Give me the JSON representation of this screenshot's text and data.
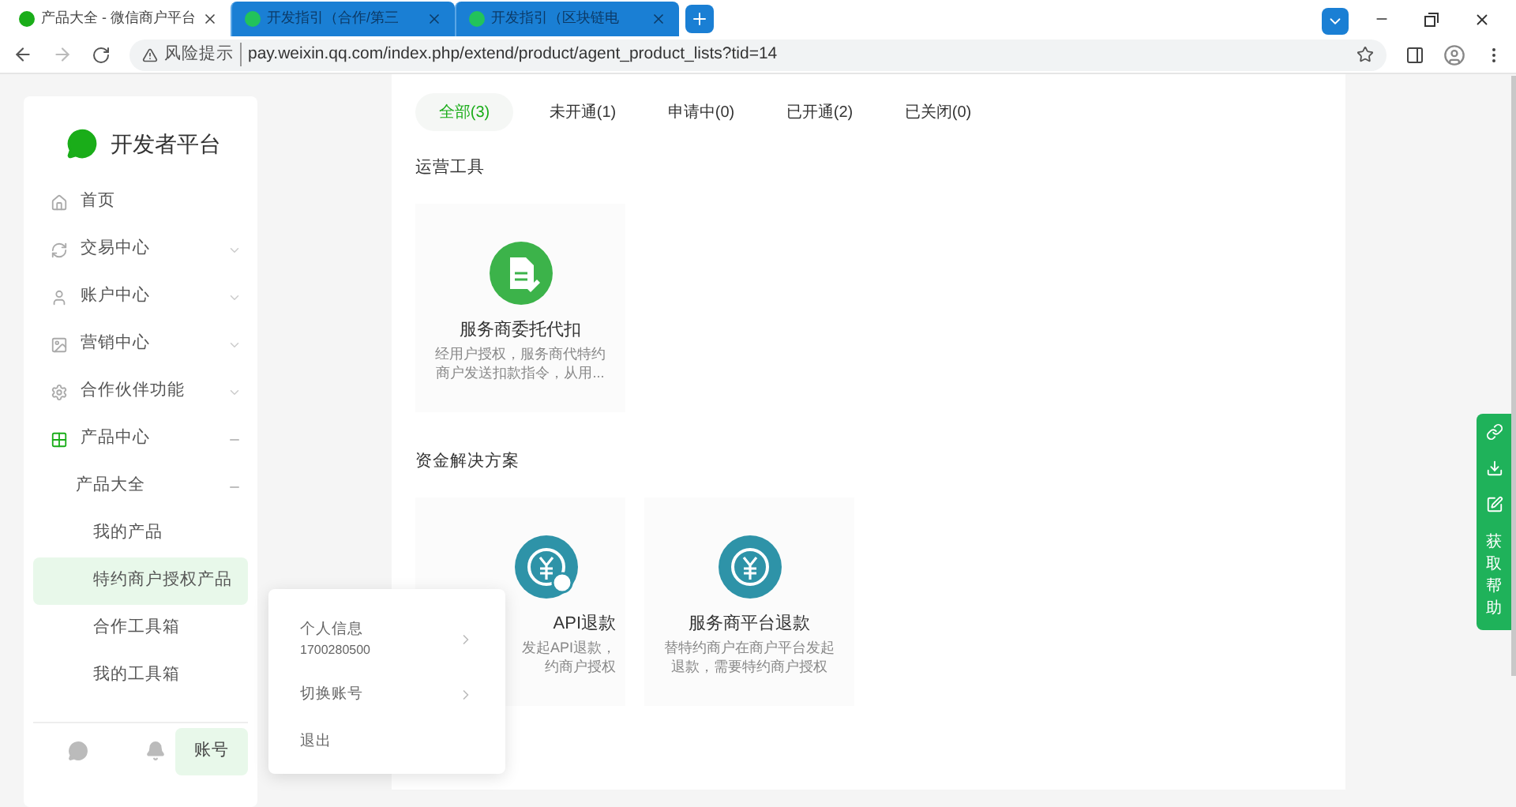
{
  "browser": {
    "tabs": [
      {
        "title": "产品大全 - 微信商户平台",
        "selected": true
      },
      {
        "title": "开发指引（合作/第三",
        "selected": false
      },
      {
        "title": "开发指引（区块链电",
        "selected": false
      }
    ],
    "address": {
      "warning": "风险提示",
      "url": "pay.weixin.qq.com/index.php/extend/product/agent_product_lists?tid=14"
    }
  },
  "sidebar": {
    "logo": "开发者平台",
    "items": [
      {
        "label": "首页"
      },
      {
        "label": "交易中心",
        "expanded": false
      },
      {
        "label": "账户中心",
        "expanded": false
      },
      {
        "label": "营销中心",
        "expanded": false
      },
      {
        "label": "合作伙伴功能",
        "expanded": false
      },
      {
        "label": "产品中心",
        "expanded": true,
        "children": [
          {
            "label": "产品大全",
            "expanded": true,
            "children": [
              {
                "label": "我的产品",
                "selected": false
              },
              {
                "label": "特约商户授权产品",
                "selected": true
              },
              {
                "label": "合作工具箱",
                "selected": false
              },
              {
                "label": "我的工具箱",
                "selected": false
              }
            ]
          }
        ]
      }
    ],
    "footer": {
      "account_button": "账号",
      "account_selected": true
    }
  },
  "account_menu": [
    {
      "label": "个人信息",
      "sub": "1700280500",
      "arrow": true
    },
    {
      "label": "切换账号",
      "arrow": true
    },
    {
      "label": "退出",
      "arrow": false
    }
  ],
  "filter_tabs": [
    {
      "label": "全部(3)",
      "selected": true
    },
    {
      "label": "未开通(1)",
      "selected": false
    },
    {
      "label": "申请中(0)",
      "selected": false
    },
    {
      "label": "已开通(2)",
      "selected": false
    },
    {
      "label": "已关闭(0)",
      "selected": false
    }
  ],
  "sections": [
    {
      "title": "运营工具",
      "cards": [
        {
          "kind": "document",
          "color": "#3cb34a",
          "covered": false,
          "title": "服务商委托代扣",
          "description": [
            "经用户授权，服务商代特约",
            "商户发送扣款指令，从用..."
          ]
        }
      ]
    },
    {
      "title": "资金解决方案",
      "cards": [
        {
          "kind": "refund-api",
          "color": "#2e93a8",
          "covered": true,
          "title": "API退款",
          "description": [
            "发起API退款，",
            "约商户授权"
          ]
        },
        {
          "kind": "refund",
          "color": "#2e93a8",
          "covered": false,
          "title": "服务商平台退款",
          "description": [
            "替特约商户在商户平台发起",
            "退款，需要特约商户授权"
          ]
        }
      ]
    }
  ],
  "help_bar": {
    "label": "获取帮助"
  }
}
